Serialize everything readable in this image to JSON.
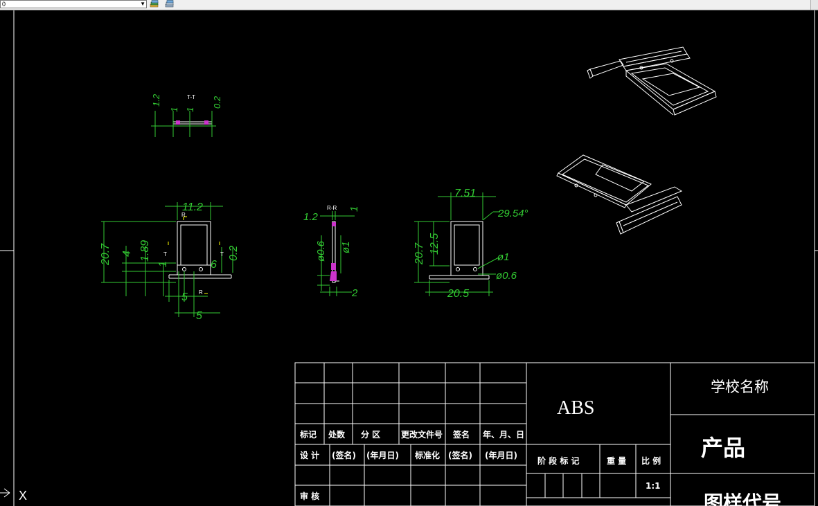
{
  "toolbar": {
    "layer_value": "0",
    "dropdown_arrow": "▼",
    "icons": [
      "layer-state-icon",
      "layer-properties-icon"
    ]
  },
  "colors": {
    "background": "#000000",
    "geometry": "#ffffff",
    "dimension": "#33cc33",
    "section_mark": "#ffff00",
    "highlight": "#cc33cc"
  },
  "views": {
    "section_tt": {
      "label": "T-T",
      "dims": [
        "1.2",
        "1",
        "1",
        "0.2"
      ]
    },
    "front_view": {
      "section_label": "R",
      "cut_label": "T",
      "dims": [
        "11.2",
        "20.7",
        "4",
        "1.89",
        "1",
        "0.2",
        "6",
        "5",
        "5"
      ]
    },
    "section_rr": {
      "label": "R-R",
      "dims": [
        "1.2",
        "1",
        "ø0.6",
        "ø1",
        "2"
      ]
    },
    "back_view": {
      "dims": [
        "7.51",
        "29.54°",
        "20.7",
        "12.5",
        "ø1",
        "ø0.6",
        "20.5"
      ]
    }
  },
  "title_block": {
    "row_labels": [
      "标记",
      "处数",
      "分 区",
      "更改文件号",
      "签名",
      "年、月、日"
    ],
    "design_row": [
      "设 计",
      "(签名)",
      "(年月日)",
      "标准化",
      "(签名)",
      "(年月日)"
    ],
    "review": "审 核",
    "material": "ABS",
    "stage_labels": [
      "阶 段 标 记",
      "重 量",
      "比 例"
    ],
    "scale": "1:1",
    "school_name": "学校名称",
    "product": "产品",
    "drawing_number": "图样代号"
  },
  "ucs": {
    "x_axis": "X"
  }
}
